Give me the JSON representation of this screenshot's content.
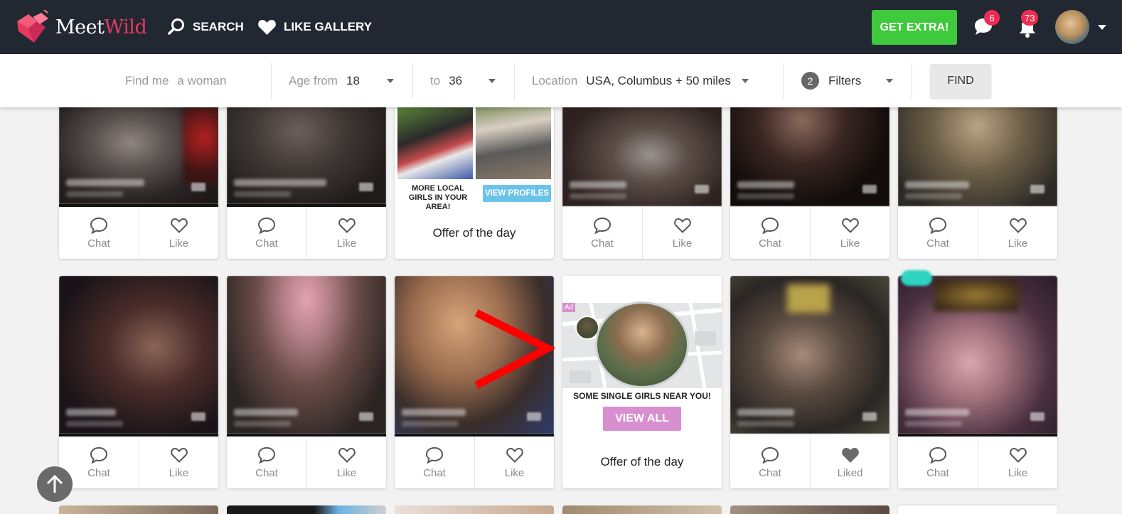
{
  "header": {
    "logo_meet": "Meet",
    "logo_wild": "Wild",
    "nav_search": "SEARCH",
    "nav_like_gallery": "LIKE GALLERY",
    "get_extra": "GET EXTRA!",
    "messages_count": "6",
    "notifications_count": "73",
    "colors": {
      "bar": "#222831",
      "accent": "#e6395f",
      "extra_button": "#3fc93c",
      "badge": "#ee2c52"
    }
  },
  "filters": {
    "find_me_label": "Find me",
    "find_me_value": "a woman",
    "age_from_label": "Age from",
    "age_from_value": "18",
    "age_to_label": "to",
    "age_to_value": "36",
    "location_label": "Location",
    "location_value": "USA, Columbus + 50 miles",
    "filters_count": "2",
    "filters_label": "Filters",
    "find_button": "FIND"
  },
  "cards": {
    "chat_label": "Chat",
    "like_label": "Like",
    "liked_label": "Liked",
    "offer_title": "Offer of the day",
    "ad1_text": "MORE LOCAL GIRLS IN YOUR AREA!",
    "ad1_button": "VIEW PROFILES",
    "ad2_tag": "Ad",
    "ad2_text": "SOME SINGLE GIRLS NEAR YOU!",
    "ad2_button": "VIEW ALL"
  }
}
